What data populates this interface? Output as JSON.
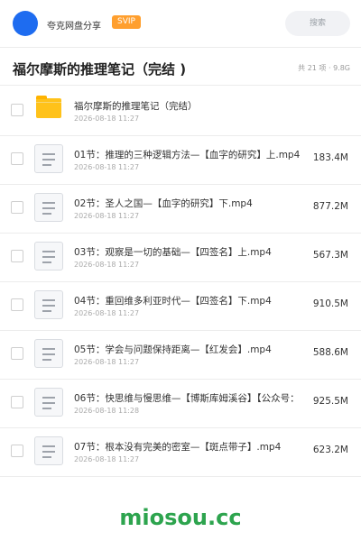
{
  "header": {
    "brand": "夸克网盘分享",
    "badge": "SVIP",
    "search_placeholder": "搜索"
  },
  "folder_title": "福尔摩斯的推理笔记（完结 )",
  "summary": "共 21 项 · 9.8G",
  "files": [
    {
      "name": "福尔摩斯的推理笔记（完结）",
      "date": "2026-08-18 11:27",
      "size": "",
      "type": "folder"
    },
    {
      "name": "01节：推理的三种逻辑方法—【血字的研究】上.mp4",
      "date": "2026-08-18 11:27",
      "size": "183.4M",
      "type": "file"
    },
    {
      "name": "02节：圣人之国—【血字的研究】下.mp4",
      "date": "2026-08-18 11:27",
      "size": "877.2M",
      "type": "file"
    },
    {
      "name": "03节：观察是一切的基础—【四签名】上.mp4",
      "date": "2026-08-18 11:27",
      "size": "567.3M",
      "type": "file"
    },
    {
      "name": "04节：重回维多利亚时代—【四签名】下.mp4",
      "date": "2026-08-18 11:27",
      "size": "910.5M",
      "type": "file"
    },
    {
      "name": "05节：学会与问题保持距离—【红发会】.mp4",
      "date": "2026-08-18 11:27",
      "size": "588.6M",
      "type": "file"
    },
    {
      "name": "06节：快思维与慢思维—【博斯库姆溪谷】【公众号：",
      "date": "2026-08-18 11:28",
      "size": "925.5M",
      "type": "file"
    },
    {
      "name": "07节：根本没有完美的密室—【斑点带子】.mp4",
      "date": "2026-08-18 11:27",
      "size": "623.2M",
      "type": "file"
    }
  ],
  "watermark": "miosou.cc"
}
